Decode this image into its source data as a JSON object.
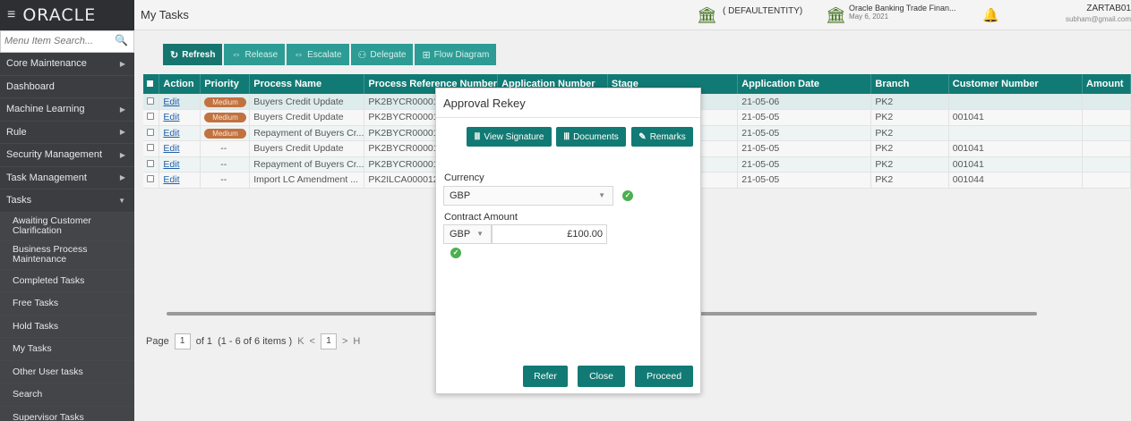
{
  "header": {
    "logo": "ORACLE",
    "page_title": "My Tasks",
    "entity": "( DEFAULTENTITY)",
    "app_name": "Oracle Banking Trade Finan...",
    "app_date": "May 6, 2021",
    "user_name": "ZARTAB01",
    "user_email": "subham@gmail.com",
    "icons": [
      "menu-icon",
      "bank-icon",
      "bell-icon"
    ]
  },
  "sidebar": {
    "search_placeholder": "Menu Item Search...",
    "items": [
      {
        "label": "Core Maintenance"
      },
      {
        "label": "Dashboard"
      },
      {
        "label": "Machine Learning"
      },
      {
        "label": "Rule"
      },
      {
        "label": "Security Management"
      },
      {
        "label": "Task Management"
      },
      {
        "label": "Tasks"
      }
    ],
    "sub_items": [
      {
        "label": "Awaiting Customer Clarification"
      },
      {
        "label": "Business Process Maintenance"
      },
      {
        "label": "Completed Tasks"
      },
      {
        "label": "Free Tasks"
      },
      {
        "label": "Hold Tasks"
      },
      {
        "label": "My Tasks"
      },
      {
        "label": "Other User tasks"
      },
      {
        "label": "Search"
      },
      {
        "label": "Supervisor Tasks"
      }
    ]
  },
  "toolbar": {
    "refresh": "Refresh",
    "release": "Release",
    "escalate": "Escalate",
    "delegate": "Delegate",
    "flow_diagram": "Flow Diagram"
  },
  "table": {
    "columns": [
      "Action",
      "Priority",
      "Process Name",
      "Process Reference Number",
      "Application Number",
      "Stage",
      "Application Date",
      "Branch",
      "Customer Number",
      "Amount"
    ],
    "rows": [
      {
        "action": "Edit",
        "priority": "Medium",
        "process": "Buyers Credit Update",
        "ref": "PK2BYCR000015",
        "date": "21-05-06",
        "branch": "PK2",
        "customer": ""
      },
      {
        "action": "Edit",
        "priority": "Medium",
        "process": "Buyers Credit Update",
        "ref": "PK2BYCR000013",
        "date": "21-05-05",
        "branch": "PK2",
        "customer": "001041"
      },
      {
        "action": "Edit",
        "priority": "Medium",
        "process": "Repayment of Buyers Cr...",
        "ref": "PK2BYCR000013",
        "date": "21-05-05",
        "branch": "PK2",
        "customer": ""
      },
      {
        "action": "Edit",
        "priority": "--",
        "process": "Buyers Credit Update",
        "ref": "PK2BYCR000013",
        "date": "21-05-05",
        "branch": "PK2",
        "customer": "001041"
      },
      {
        "action": "Edit",
        "priority": "--",
        "process": "Repayment of Buyers Cr...",
        "ref": "PK2BYCR000013",
        "date": "21-05-05",
        "branch": "PK2",
        "customer": "001041"
      },
      {
        "action": "Edit",
        "priority": "--",
        "process": "Import LC Amendment ...",
        "ref": "PK2ILCA000012",
        "date": "21-05-05",
        "branch": "PK2",
        "customer": "001044"
      }
    ]
  },
  "pager": {
    "page_label": "Page",
    "page_value": "1",
    "of_text": "of 1",
    "items_text": "(1 - 6 of 6 items )",
    "current": "1",
    "first": "K",
    "prev": "<",
    "next": ">",
    "last": "H"
  },
  "modal": {
    "title": "Approval Rekey",
    "view_signature": "View Signature",
    "documents": "Documents",
    "remarks": "Remarks",
    "currency_label": "Currency",
    "currency_value": "GBP",
    "contract_amount_label": "Contract Amount",
    "amount_currency": "GBP",
    "amount_value": "£100.00",
    "refer": "Refer",
    "close": "Close",
    "proceed": "Proceed"
  },
  "colors": {
    "accent": "#127a74",
    "sidebar_bg": "#3b3d41",
    "priority_badge": "#c2723f",
    "ok_green": "#4caf50"
  }
}
